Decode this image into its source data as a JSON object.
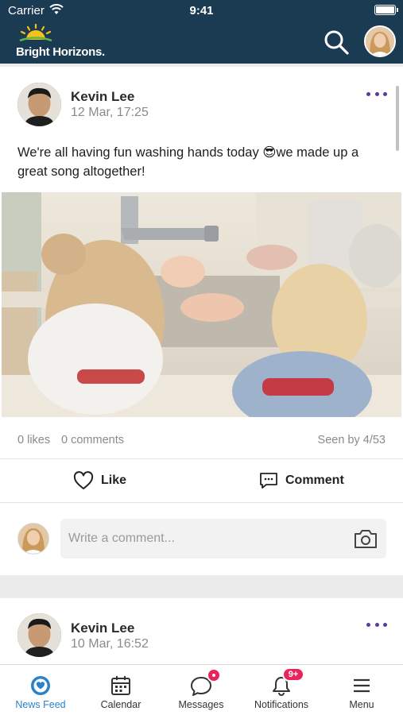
{
  "status_bar": {
    "carrier": "Carrier",
    "time": "9:41"
  },
  "header": {
    "logo_text": "Bright Horizons.",
    "brand_sun_color": "#f4c21a",
    "background_color": "#1b3b52",
    "icons": [
      "search-icon",
      "user-avatar"
    ]
  },
  "post": {
    "author": "Kevin Lee",
    "date": "12 Mar, 17:25",
    "text_before_emoji": "We're all having fun washing hands today ",
    "emoji": "😎",
    "text_after_emoji": "we made up a great song altogether!",
    "likes": "0 likes",
    "comments": "0 comments",
    "seen": "Seen by 4/53",
    "like_label": "Like",
    "comment_label": "Comment",
    "comment_placeholder": "Write a comment..."
  },
  "post2": {
    "author": "Kevin Lee",
    "date": "10 Mar, 16:52"
  },
  "tabs": [
    {
      "label": "News Feed",
      "icon": "news-feed-icon",
      "active": true
    },
    {
      "label": "Calendar",
      "icon": "calendar-icon"
    },
    {
      "label": "Messages",
      "icon": "messages-icon",
      "badge": "dot"
    },
    {
      "label": "Notifications",
      "icon": "bell-icon",
      "badge": "9+"
    },
    {
      "label": "Menu",
      "icon": "menu-icon"
    }
  ],
  "accent_color": "#2a82c8",
  "badge_color": "#e8245a",
  "more_dots_color": "#5a3a9a"
}
